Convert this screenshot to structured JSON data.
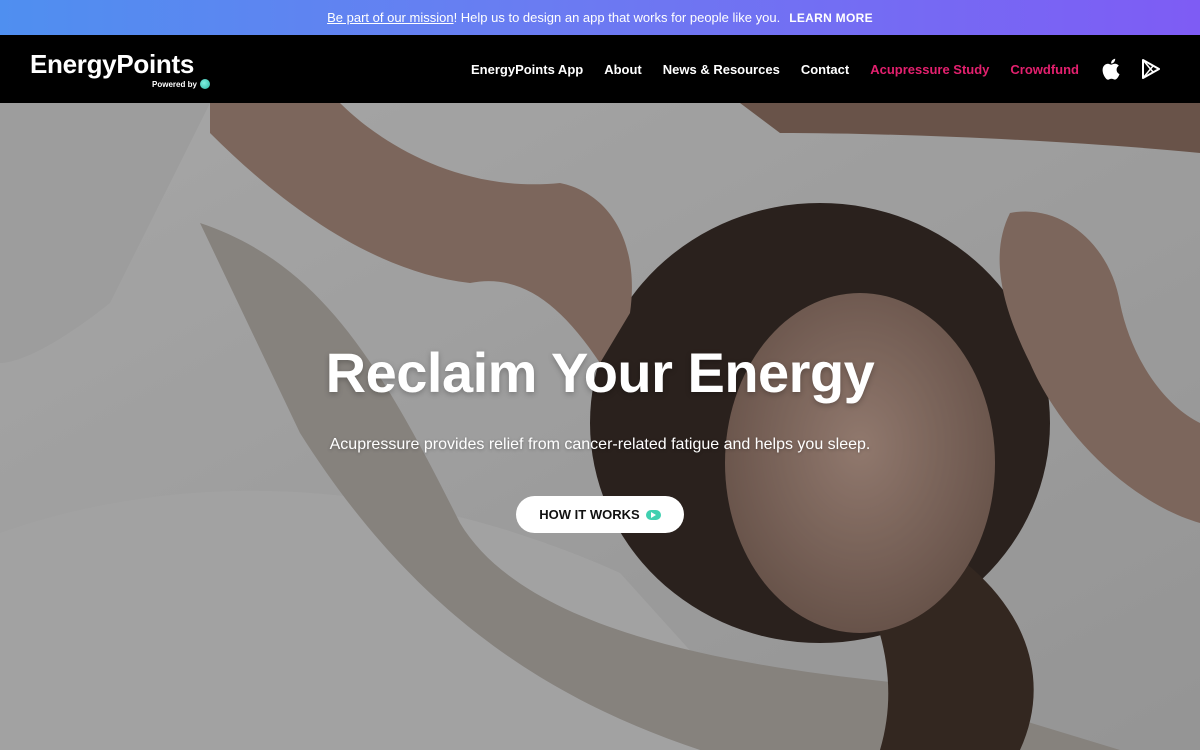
{
  "announcement": {
    "link_text": "Be part of our mission",
    "message": "! Help us to design an app that works for people like you.",
    "cta": "LEARN MORE"
  },
  "header": {
    "brand": "EnergyPoints",
    "powered_by": "Powered by",
    "nav": [
      {
        "label": "EnergyPoints App"
      },
      {
        "label": "About"
      },
      {
        "label": "News & Resources"
      },
      {
        "label": "Contact"
      },
      {
        "label": "Acupressure Study",
        "highlight": true
      },
      {
        "label": "Crowdfund",
        "highlight": true
      }
    ],
    "store_icons": [
      "apple-icon",
      "google-play-icon"
    ],
    "accent_color": "#e3206e"
  },
  "hero": {
    "title": "Reclaim Your Energy",
    "subtitle": "Acupressure provides relief from cancer-related fatigue and helps you sleep.",
    "button_label": "HOW IT WORKS",
    "button_icon": "play-icon"
  },
  "colors": {
    "announce_gradient_start": "#4f8ff0",
    "announce_gradient_end": "#7e5cf4",
    "header_bg": "#000000",
    "play_icon": "#3fd0b0"
  }
}
